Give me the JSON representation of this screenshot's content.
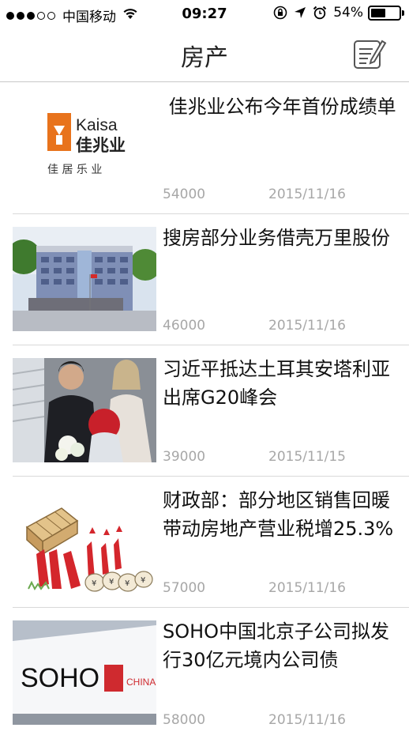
{
  "status_bar": {
    "carrier": "中国移动",
    "time": "09:27",
    "battery_percent": "54%",
    "battery_level": 0.54,
    "signal_bars_filled": 3,
    "signal_bars_total": 5,
    "icons": [
      "wifi-icon",
      "orientation-lock-icon",
      "location-icon",
      "alarm-icon",
      "battery-icon"
    ]
  },
  "nav": {
    "title": "房产",
    "right_icon": "compose-icon"
  },
  "news": [
    {
      "title": " 佳兆业公布今年首份成绩单",
      "count": "54000",
      "date": "2015/11/16",
      "thumb_icon": "kaisa-logo-image",
      "thumb_texts": {
        "brand": "Kaisa",
        "brand_cn": "佳兆业",
        "slogan": "佳 居 乐 业"
      }
    },
    {
      "title": "搜房部分业务借壳万里股份",
      "count": "46000",
      "date": "2015/11/16",
      "thumb_icon": "wanli-building-photo"
    },
    {
      "title": "习近平抵达土耳其安塔利亚 出席G20峰会",
      "count": "39000",
      "date": "2015/11/15",
      "thumb_icon": "xi-arrival-photo"
    },
    {
      "title": "财政部：部分地区销售回暖带动房地产营业税增25.3%",
      "count": "57000",
      "date": "2015/11/16",
      "thumb_icon": "real-estate-cartoon-image"
    },
    {
      "title": "SOHO中国北京子公司拟发行30亿元境内公司债",
      "count": "58000",
      "date": "2015/11/16",
      "thumb_icon": "soho-china-sign-photo",
      "thumb_texts": {
        "brand": "SOHO",
        "brand_cn": "CHINA"
      }
    }
  ],
  "colors": {
    "meta_text": "#a7a7a7",
    "divider": "#d9d9d9",
    "kaisa_orange": "#e8731c"
  }
}
